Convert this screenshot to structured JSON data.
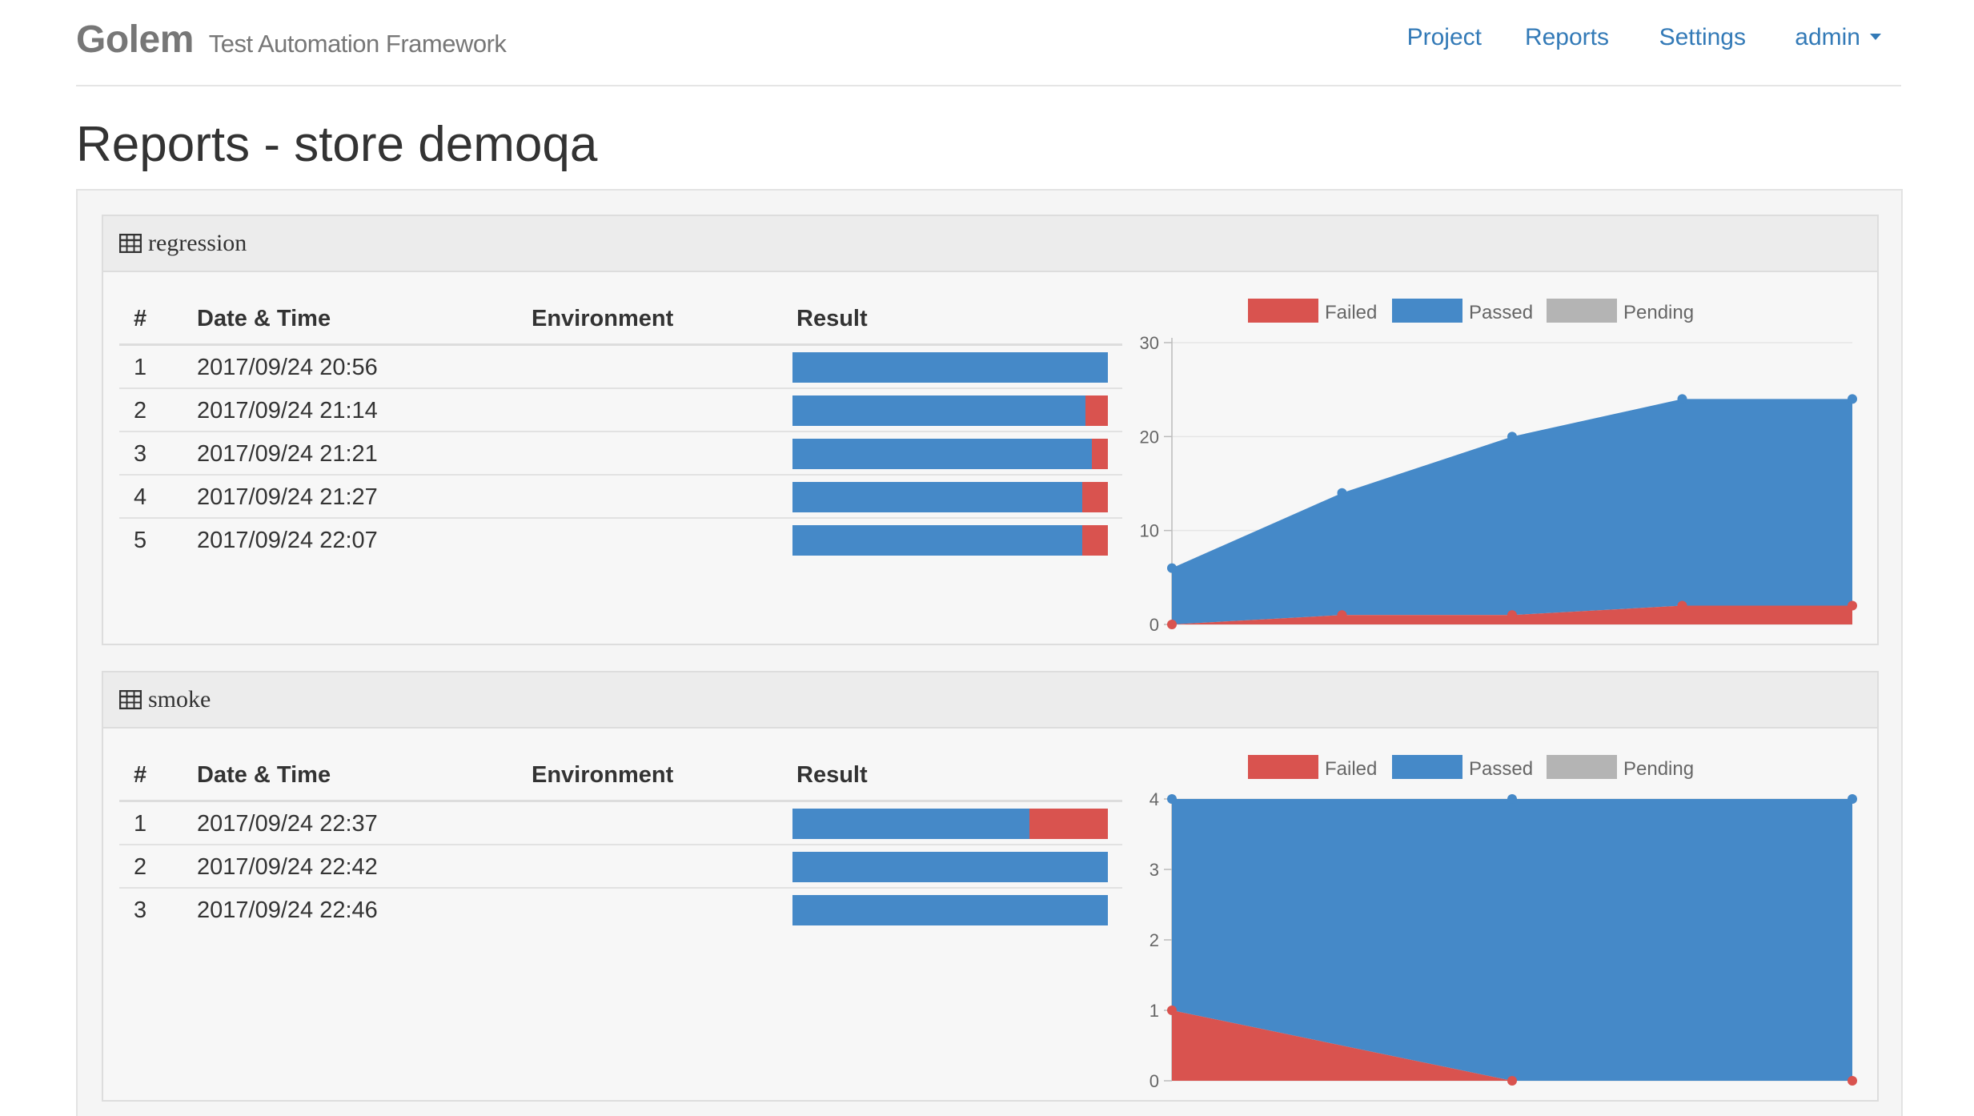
{
  "navbar": {
    "brand": "Golem",
    "tagline": "Test Automation Framework",
    "links": [
      "Project",
      "Reports",
      "Settings"
    ],
    "user": "admin"
  },
  "page_title": "Reports - store demoqa",
  "columns": [
    "#",
    "Date & Time",
    "Environment",
    "Result"
  ],
  "colors": {
    "failed": "#d9534f",
    "passed": "#4589c8",
    "pending": "#b4b4b4"
  },
  "icons": {
    "panel_icon": "table-icon",
    "user_menu": "caret-down-icon"
  },
  "suites": [
    {
      "name": "regression",
      "rows": [
        {
          "num": "1",
          "datetime": "2017/09/24 20:56",
          "environment": "",
          "passed": 1.0,
          "failed": 0.0
        },
        {
          "num": "2",
          "datetime": "2017/09/24 21:14",
          "environment": "",
          "passed": 0.93,
          "failed": 0.07
        },
        {
          "num": "3",
          "datetime": "2017/09/24 21:21",
          "environment": "",
          "passed": 0.95,
          "failed": 0.05
        },
        {
          "num": "4",
          "datetime": "2017/09/24 21:27",
          "environment": "",
          "passed": 0.92,
          "failed": 0.08
        },
        {
          "num": "5",
          "datetime": "2017/09/24 22:07",
          "environment": "",
          "passed": 0.92,
          "failed": 0.08
        }
      ]
    },
    {
      "name": "smoke",
      "rows": [
        {
          "num": "1",
          "datetime": "2017/09/24 22:37",
          "environment": "",
          "passed": 0.75,
          "failed": 0.25
        },
        {
          "num": "2",
          "datetime": "2017/09/24 22:42",
          "environment": "",
          "passed": 1.0,
          "failed": 0.0
        },
        {
          "num": "3",
          "datetime": "2017/09/24 22:46",
          "environment": "",
          "passed": 1.0,
          "failed": 0.0
        }
      ]
    }
  ],
  "chart_data": [
    {
      "type": "area",
      "stacked": true,
      "legend": [
        "Failed",
        "Passed",
        "Pending"
      ],
      "legend_position": "top",
      "ylim": [
        0,
        30
      ],
      "yticks": [
        0,
        10,
        20,
        30
      ],
      "grid": true,
      "x": [
        1,
        2,
        3,
        4,
        5
      ],
      "series": [
        {
          "name": "Failed",
          "values": [
            0,
            1,
            1,
            2,
            2
          ]
        },
        {
          "name": "Passed",
          "values": [
            6,
            13,
            19,
            22,
            22
          ]
        },
        {
          "name": "Pending",
          "values": [
            0,
            0,
            0,
            0,
            0
          ]
        }
      ]
    },
    {
      "type": "area",
      "stacked": true,
      "legend": [
        "Failed",
        "Passed",
        "Pending"
      ],
      "legend_position": "top",
      "ylim": [
        0,
        4
      ],
      "yticks": [
        0,
        1,
        2,
        3,
        4
      ],
      "grid": true,
      "x": [
        1,
        2,
        3
      ],
      "series": [
        {
          "name": "Failed",
          "values": [
            1,
            0,
            0
          ]
        },
        {
          "name": "Passed",
          "values": [
            3,
            4,
            4
          ]
        },
        {
          "name": "Pending",
          "values": [
            0,
            0,
            0
          ]
        }
      ]
    }
  ]
}
